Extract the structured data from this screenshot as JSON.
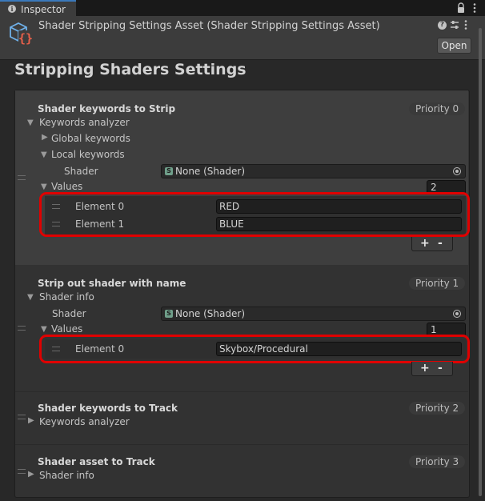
{
  "tab": {
    "label": "Inspector",
    "info_icon": "i"
  },
  "window_controls": {
    "lock_icon": "lock-icon",
    "menu_icon": "kebab-icon"
  },
  "header": {
    "asset_title": "Shader Stripping Settings Asset (Shader Stripping Settings Asset)",
    "help_icon": "?",
    "open_label": "Open"
  },
  "page_title": "Stripping Shaders Settings",
  "sections": [
    {
      "title": "Shader keywords to Strip",
      "priority": "Priority 0",
      "foldout": "Keywords analyzer",
      "global_keywords": "Global keywords",
      "local_keywords": "Local keywords",
      "shader_label": "Shader",
      "shader_value": "None (Shader)",
      "values_label": "Values",
      "values_count": "2",
      "elements": [
        {
          "label": "Element 0",
          "value": "RED"
        },
        {
          "label": "Element 1",
          "value": "BLUE"
        }
      ]
    },
    {
      "title": "Strip out shader with name",
      "priority": "Priority 1",
      "foldout": "Shader info",
      "shader_label": "Shader",
      "shader_value": "None (Shader)",
      "values_label": "Values",
      "values_count": "1",
      "elements": [
        {
          "label": "Element 0",
          "value": "Skybox/Procedural"
        }
      ]
    },
    {
      "title": "Shader keywords to Track",
      "priority": "Priority 2",
      "foldout": "Keywords analyzer"
    },
    {
      "title": "Shader asset to Track",
      "priority": "Priority 3",
      "foldout": "Shader info"
    }
  ],
  "list_controls": {
    "add": "+",
    "remove": "-"
  },
  "colors": {
    "highlight_border": "#e00000",
    "accent": "#3a79bb"
  }
}
